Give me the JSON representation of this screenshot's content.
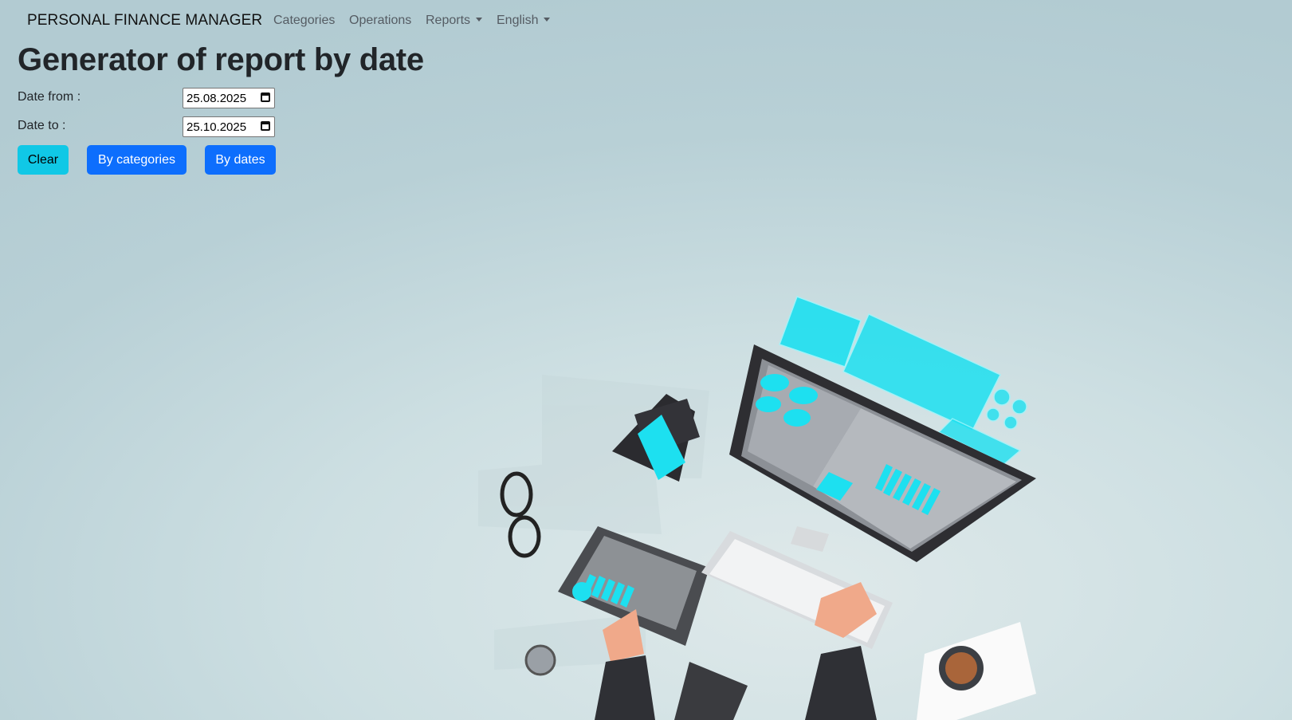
{
  "navbar": {
    "brand": "PERSONAL FINANCE MANAGER",
    "items": [
      {
        "label": "Categories"
      },
      {
        "label": "Operations"
      },
      {
        "label": "Reports",
        "dropdown": true
      },
      {
        "label": "English",
        "dropdown": true
      }
    ]
  },
  "page": {
    "title": "Generator of report by date"
  },
  "form": {
    "date_from_label": "Date from :",
    "date_from_value": "25.08.2025",
    "date_to_label": "Date to :",
    "date_to_value": "25.10.2025"
  },
  "buttons": {
    "clear": "Clear",
    "by_categories": "By categories",
    "by_dates": "By dates"
  },
  "colors": {
    "primary": "#0d6efd",
    "info": "#10c8e6",
    "accent_illustration": "#1de0f0"
  }
}
